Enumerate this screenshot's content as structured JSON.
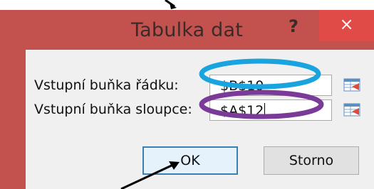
{
  "dialog": {
    "title": "Tabulka dat",
    "help_label": "?",
    "close_label": "×"
  },
  "row_input": {
    "label": "Vstupní buňka řádku:",
    "value": "$B$10"
  },
  "column_input": {
    "label": "Vstupní buňka sloupce:",
    "value": "$A$12"
  },
  "buttons": {
    "ok_label": "OK",
    "cancel_label": "Storno"
  },
  "annotations": {
    "row_highlight_color": "#19a4e0",
    "column_highlight_color": "#7a3a97"
  }
}
